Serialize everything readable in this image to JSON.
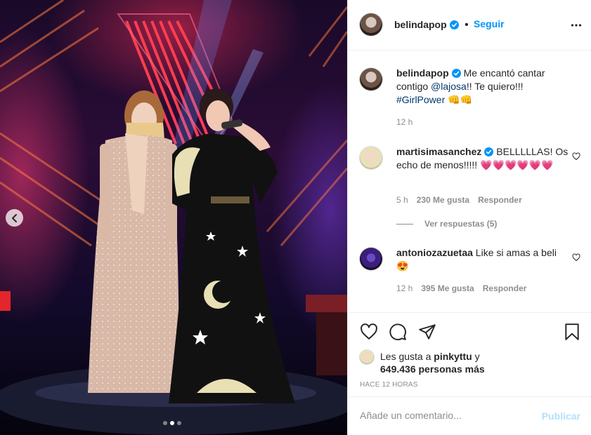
{
  "post": {
    "username": "belindapop",
    "follow_label": "Seguir",
    "more_icon": "more-horizontal-icon",
    "verified_color": "#0095f6",
    "carousel": {
      "total": 3,
      "active_index": 1
    }
  },
  "caption": {
    "username": "belindapop",
    "text_1": "Me encantó cantar contigo ",
    "mention": "@lajosa",
    "text_2": "!! Te quiero!!! ",
    "hashtag": "#GirlPower",
    "emoji": "👊👊",
    "time": "12 h"
  },
  "comments": [
    {
      "username": "martisimasanchez",
      "verified": true,
      "text": "BELLLLLAS! Os echo de menos!!!!! ",
      "hearts": "💗💗💗💗💗💗",
      "time": "5 h",
      "likes": "230 Me gusta",
      "reply": "Responder",
      "view_replies": "Ver respuestas (5)"
    },
    {
      "username": "antoniozazuetaa",
      "verified": false,
      "text": "Like si amas a beli ",
      "emoji": "😍",
      "time": "12 h",
      "likes": "395 Me gusta",
      "reply": "Responder"
    }
  ],
  "actions": {
    "like_icon": "heart-icon",
    "comment_icon": "comment-icon",
    "share_icon": "paper-plane-icon",
    "save_icon": "bookmark-icon"
  },
  "likes": {
    "prefix": "Les gusta a ",
    "user": "pinkyttu",
    "suffix": " y",
    "others": "649.436 personas más"
  },
  "timestamp": "HACE 12 HORAS",
  "add_comment": {
    "placeholder": "Añade un comentario...",
    "publish_label": "Publicar",
    "publish_color": "#b2dffc"
  }
}
